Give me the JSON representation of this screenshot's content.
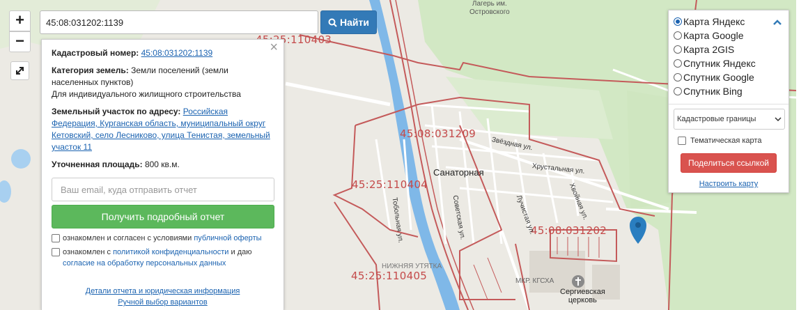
{
  "map": {
    "cadastral_labels": [
      "45:25:110403",
      "45:08:031209",
      "45:25:110404",
      "45:08:031202",
      "45:25:110405"
    ],
    "places": {
      "camp": [
        "Лагерь им.",
        "Островского"
      ],
      "sanatornaya": "Санаторная",
      "nizhnyaya": "НИЖНЯЯ УТЯТКА",
      "mkr": "МКР. КГСХА",
      "church": [
        "Сергиевская",
        "церковь"
      ]
    },
    "streets": [
      "Звёздная ул.",
      "Хрустальная ул.",
      "Хвойная ул.",
      "Лучистая ул.",
      "Советская ул.",
      "Тобольная ул."
    ],
    "colors": {
      "parcel_border": "#c45a5a",
      "river": "#7fb8e8",
      "forest": "#d2e8c4",
      "marker": "#2a7ec0"
    }
  },
  "controls": {
    "zoom_in": "+",
    "zoom_out": "−",
    "fullscreen_icon": "expand-icon"
  },
  "search": {
    "value": "45:08:031202:1139",
    "button_label": "Найти",
    "button_icon": "search-icon"
  },
  "info": {
    "cadastral_label": "Кадастровый номер:",
    "cadastral_value": "45:08:031202:1139",
    "category_label": "Категория земель:",
    "category_value": "Земли поселений (земли населенных пунктов)",
    "usage": "Для индивидуального жилищного строительства",
    "address_label": "Земельный участок по адресу:",
    "address_value": "Российская Федерация, Курганская область, муниципальный округ Кетовский, село Лесниково, улица Тенистая, земельный участок 11",
    "area_label": "Уточненная площадь:",
    "area_value": "800 кв.м.",
    "email_placeholder": "Ваш email, куда отправить отчет",
    "report_button": "Получить подробный отчет",
    "consent1_text": "ознакомлен и согласен с условиями",
    "consent1_link": "публичной оферты",
    "consent2_text": "ознакомлен с",
    "consent2_link": "политикой конфиденциальности",
    "consent2_mid": "и даю",
    "consent2_link2": "согласие на обработку персональных данных",
    "details_link": "Детали отчета и юридическая информация",
    "manual_link": "Ручной выбор вариантов"
  },
  "layers": {
    "options": [
      "Карта Яндекс",
      "Карта Google",
      "Карта 2GIS",
      "Спутник Яндекс",
      "Спутник Google",
      "Спутник Bing"
    ],
    "selected_index": 0,
    "select_value": "Кадастровые границы",
    "thematic_label": "Тематическая карта",
    "share_button": "Поделиться ссылкой",
    "configure_link": "Настроить карту"
  }
}
